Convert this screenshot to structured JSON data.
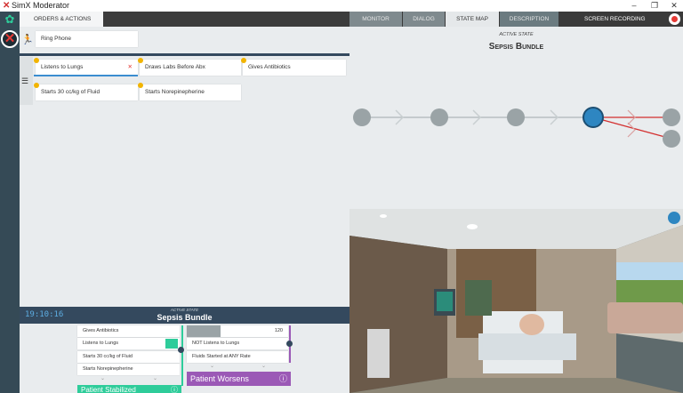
{
  "window": {
    "title": "SimX Moderator",
    "controls": [
      "–",
      "❐",
      "✕"
    ]
  },
  "left_tab": "ORDERS & ACTIONS",
  "nav_tabs": [
    "MONITOR",
    "DIALOG",
    "STATE MAP",
    "DESCRIPTION"
  ],
  "screen_recording": "SCREEN RECORDING",
  "ring_phone": "Ring Phone",
  "actions": {
    "row1": [
      "Listens to Lungs",
      "Draws Labs Before Abx",
      "Gives Antibiotics"
    ],
    "row2": [
      "Starts 30 cc/kg of Fluid",
      "Starts Norepinepherine"
    ],
    "remove_glyph": "✕"
  },
  "state_map": {
    "active_label": "ACTIVE STATE",
    "active_name": "Sepsis Bundle"
  },
  "timer": "19:10:16",
  "bottom": {
    "active_label": "ACTIVE STATE",
    "active_name": "Sepsis Bundle",
    "left_items": [
      "Gives Antibiotics",
      "Listens to Lungs",
      "Starts 30 cc/kg of Fluid",
      "Starts Norepinepherine"
    ],
    "right_items": [
      "NOT Listens to Lungs",
      "Fluids Started at ANY Rate"
    ],
    "progress_value": "120",
    "outcome_left": "Patient Stabilized",
    "outcome_right": "Patient Worsens",
    "info_glyph": "ⓘ"
  },
  "colors": {
    "accent_green": "#2ecc9a",
    "purple": "#9b59b6",
    "blue_node": "#2e86c1",
    "gray_node": "#9aa3a6"
  }
}
